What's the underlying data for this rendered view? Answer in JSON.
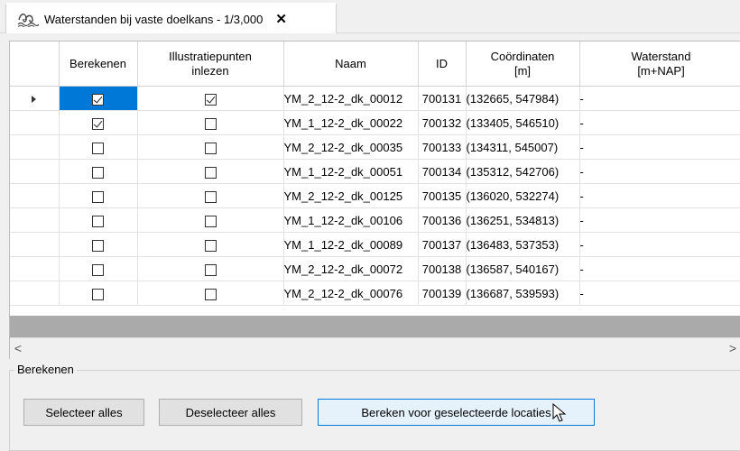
{
  "tab": {
    "title": "Waterstanden bij vaste doelkans - 1/3,000",
    "close_label": "✕"
  },
  "grid": {
    "headers": {
      "berekenen": "Berekenen",
      "illustratie": "Illustratiepunten inlezen",
      "naam": "Naam",
      "id": "ID",
      "coordinaten": "Coördinaten [m]",
      "waterstand": "Waterstand [m+NAP]"
    },
    "rows": [
      {
        "current": true,
        "berekenen": true,
        "illustratie": true,
        "naam": "YM_2_12-2_dk_00012",
        "id": "700131",
        "coord": "(132665, 547984)",
        "waterstand": "-"
      },
      {
        "current": false,
        "berekenen": true,
        "illustratie": false,
        "naam": "YM_1_12-2_dk_00022",
        "id": "700132",
        "coord": "(133405, 546510)",
        "waterstand": "-"
      },
      {
        "current": false,
        "berekenen": false,
        "illustratie": false,
        "naam": "YM_2_12-2_dk_00035",
        "id": "700133",
        "coord": "(134311, 545007)",
        "waterstand": "-"
      },
      {
        "current": false,
        "berekenen": false,
        "illustratie": false,
        "naam": "YM_1_12-2_dk_00051",
        "id": "700134",
        "coord": "(135312, 542706)",
        "waterstand": "-"
      },
      {
        "current": false,
        "berekenen": false,
        "illustratie": false,
        "naam": "YM_2_12-2_dk_00125",
        "id": "700135",
        "coord": "(136020, 532274)",
        "waterstand": "-"
      },
      {
        "current": false,
        "berekenen": false,
        "illustratie": false,
        "naam": "YM_1_12-2_dk_00106",
        "id": "700136",
        "coord": "(136251, 534813)",
        "waterstand": "-"
      },
      {
        "current": false,
        "berekenen": false,
        "illustratie": false,
        "naam": "YM_1_12-2_dk_00089",
        "id": "700137",
        "coord": "(136483, 537353)",
        "waterstand": "-"
      },
      {
        "current": false,
        "berekenen": false,
        "illustratie": false,
        "naam": "YM_2_12-2_dk_00072",
        "id": "700138",
        "coord": "(136587, 540167)",
        "waterstand": "-"
      },
      {
        "current": false,
        "berekenen": false,
        "illustratie": false,
        "naam": "YM_2_12-2_dk_00076",
        "id": "700139",
        "coord": "(136687, 539593)",
        "waterstand": "-"
      }
    ]
  },
  "scroll": {
    "left_arrow": "<",
    "right_arrow": ">"
  },
  "group": {
    "legend": "Berekenen",
    "select_all": "Selecteer alles",
    "deselect_all": "Deselecteer alles",
    "calculate": "Bereken voor geselecteerde locaties"
  },
  "colors": {
    "selection": "#0078d7",
    "band": "#aaaaaa"
  },
  "icons": {
    "tab": "water-level-icon",
    "current_row": "row-pointer-icon",
    "cursor": "mouse-pointer-icon"
  }
}
